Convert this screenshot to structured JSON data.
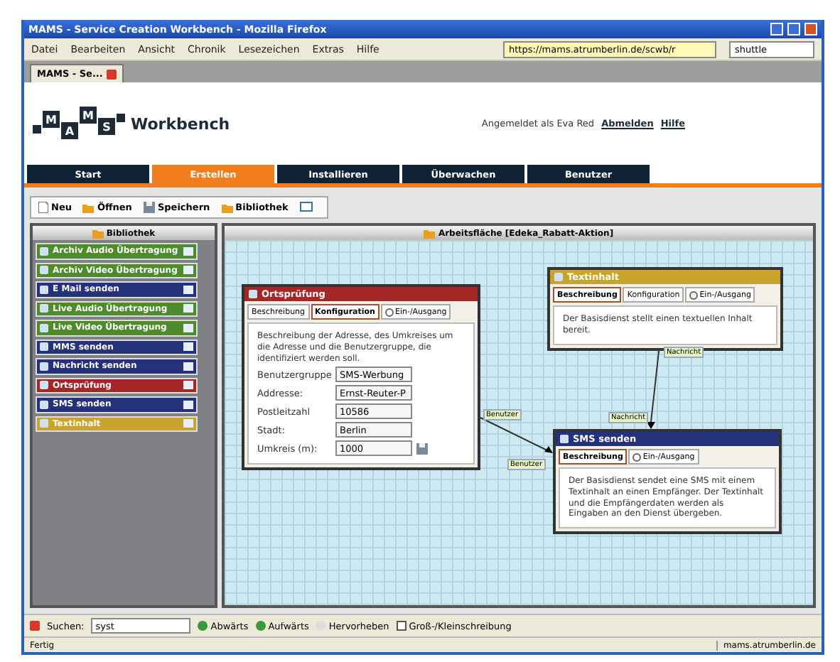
{
  "window": {
    "title": "MAMS - Service Creation Workbench - Mozilla Firefox"
  },
  "menu": [
    "Datei",
    "Bearbeiten",
    "Ansicht",
    "Chronik",
    "Lesezeichen",
    "Extras",
    "Hilfe"
  ],
  "address_bar": {
    "value": "https://mams.atrumberlin.de/scwb/r"
  },
  "search_box": {
    "value": "shuttle"
  },
  "browser_tabs": [
    {
      "label": "MAMS - Se...",
      "selected": true
    }
  ],
  "header": {
    "logo_letters": [
      "M",
      "A",
      "M",
      "S"
    ],
    "app_name": "Workbench",
    "user": "Angemeldet als Eva Red",
    "links": [
      "Abmelden",
      "Hilfe"
    ]
  },
  "nav_tabs": [
    {
      "label": "Start",
      "selected": false
    },
    {
      "label": "Erstellen",
      "selected": true
    },
    {
      "label": "Installieren",
      "selected": false
    },
    {
      "label": "Überwachen",
      "selected": false
    },
    {
      "label": "Benutzer",
      "selected": false
    }
  ],
  "toolbar": [
    "Neu",
    "Öffnen",
    "Speichern",
    "Bibliothek"
  ],
  "library": {
    "title": "Bibliothek",
    "items": [
      {
        "name": "Archiv Audio Übertragung",
        "color": "#4f8a2c"
      },
      {
        "name": "Archiv Video Übertragung",
        "color": "#4f8a2c"
      },
      {
        "name": "E Mail senden",
        "color": "#25317a"
      },
      {
        "name": "Live Audio Übertragung",
        "color": "#4f8a2c"
      },
      {
        "name": "Live Video Übertragung",
        "color": "#4f8a2c"
      },
      {
        "name": "MMS senden",
        "color": "#25317a"
      },
      {
        "name": "Nachricht senden",
        "color": "#25317a"
      },
      {
        "name": "Ortsprüfung",
        "color": "#a52626"
      },
      {
        "name": "SMS senden",
        "color": "#25317a"
      },
      {
        "name": "Textinhalt",
        "color": "#c8a42c"
      }
    ]
  },
  "canvas": {
    "title": "Arbeitsfläche [Edeka_Rabatt-Aktion]",
    "nodes": [
      {
        "title": "Ortsprüfung",
        "color": "#a52626",
        "tabs": [
          {
            "label": "Beschreibung",
            "selected": false,
            "kind": "text"
          },
          {
            "label": "Konfiguration",
            "selected": true,
            "kind": "text"
          },
          {
            "label": "Ein-/Ausgang",
            "selected": false,
            "kind": "radio"
          }
        ],
        "description": "Beschreibung der Adresse, des Umkreises um die Adresse und die Benutzergruppe, die identifiziert werden soll.",
        "fields": [
          {
            "label": "Benutzergruppe",
            "value": "SMS-Werbung"
          },
          {
            "label": "Addresse:",
            "value": "Ernst-Reuter-P"
          },
          {
            "label": "Postleitzahl",
            "value": "10586"
          },
          {
            "label": "Stadt:",
            "value": "Berlin"
          },
          {
            "label": "Umkreis (m):",
            "value": "1000"
          }
        ]
      },
      {
        "title": "Textinhalt",
        "color": "#c8a42c",
        "tabs": [
          {
            "label": "Beschreibung",
            "selected": true,
            "kind": "text"
          },
          {
            "label": "Konfiguration",
            "selected": false,
            "kind": "text"
          },
          {
            "label": "Ein-/Ausgang",
            "selected": false,
            "kind": "radio"
          }
        ],
        "description": "Der Basisdienst stellt einen textuellen Inhalt bereit."
      },
      {
        "title": "SMS senden",
        "color": "#25317a",
        "tabs": [
          {
            "label": "Beschreibung",
            "selected": true,
            "kind": "text"
          },
          {
            "label": "Ein-/Ausgang",
            "selected": false,
            "kind": "radio"
          }
        ],
        "description": "Der Basisdienst sendet eine SMS mit einem Textinhalt an einen Empfänger. Der Textinhalt und die Empfängerdaten werden als Eingaben an den Dienst übergeben."
      }
    ],
    "port_labels": [
      "Benutzer",
      "Benutzer",
      "Nachricht",
      "Nachricht"
    ]
  },
  "find_bar": {
    "label": "Suchen:",
    "value": "syst",
    "buttons": [
      "Abwärts",
      "Aufwärts",
      "Hervorheben"
    ],
    "checkbox": {
      "label": "Groß-/Kleinschreibung",
      "checked": false
    }
  },
  "status_bar": {
    "text": "Fertig",
    "host": "mams.atrumberlin.de"
  }
}
